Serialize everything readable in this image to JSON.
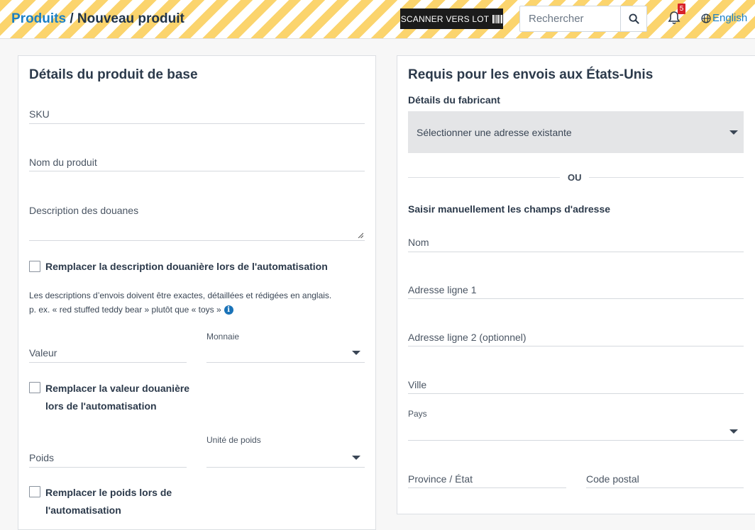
{
  "header": {
    "breadcrumb_link": "Produits",
    "breadcrumb_sep": " / ",
    "breadcrumb_current": "Nouveau produit",
    "scan_label": "SCANNER VERS LOT",
    "search_placeholder": "Rechercher",
    "notification_count": "5",
    "language": "English",
    "accent_color": "#fbd46d",
    "link_color": "#1a7fc4"
  },
  "left": {
    "title": "Détails du produit de base",
    "sku": "SKU",
    "name": "Nom du produit",
    "customs_desc": "Description des douanes",
    "replace_desc": "Remplacer la description douanière lors de l'automatisation",
    "help_line1": "Les descriptions d’envois doivent être exactes, détaillées et rédigées en anglais.",
    "help_line2": "p. ex. « red stuffed teddy bear » plutôt que « toys »",
    "value": "Valeur",
    "currency": "Monnaie",
    "replace_value_1": "Remplacer la valeur douanière",
    "replace_value_2": "lors de l'automatisation",
    "weight": "Poids",
    "weight_unit": "Unité de poids",
    "replace_weight_1": "Remplacer le poids lors de",
    "replace_weight_2": "l'automatisation"
  },
  "right": {
    "title": "Requis pour les envois aux États-Unis",
    "manufacturer": "Détails du fabricant",
    "select_existing": "Sélectionner une adresse existante",
    "or": "OU",
    "manual": "Saisir manuellement les champs d'adresse",
    "name": "Nom",
    "address1": "Adresse ligne 1",
    "address2": "Adresse ligne 2 (optionnel)",
    "city": "Ville",
    "country": "Pays",
    "province": "Province / État",
    "postal": "Code postal"
  }
}
